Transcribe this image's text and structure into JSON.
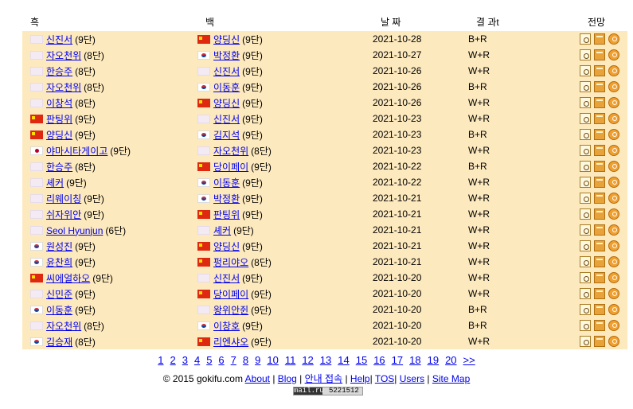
{
  "headers": {
    "black": "흑",
    "white": "백",
    "date": "날 짜",
    "result": "결 과t",
    "view": "전망"
  },
  "rows": [
    {
      "black": {
        "flag": "none",
        "name": "신진서",
        "rank": "(9단)"
      },
      "white": {
        "flag": "cn",
        "name": "양딩신",
        "rank": "(9단)"
      },
      "date": "2021-10-28",
      "result": "B+R"
    },
    {
      "black": {
        "flag": "none",
        "name": "자오천위",
        "rank": "(8단)"
      },
      "white": {
        "flag": "kr",
        "name": "박정환",
        "rank": "(9단)"
      },
      "date": "2021-10-27",
      "result": "W+R"
    },
    {
      "black": {
        "flag": "none",
        "name": "한승주",
        "rank": "(8단)"
      },
      "white": {
        "flag": "none",
        "name": "신진서",
        "rank": "(9단)"
      },
      "date": "2021-10-26",
      "result": "W+R"
    },
    {
      "black": {
        "flag": "none",
        "name": "자오천위",
        "rank": "(8단)"
      },
      "white": {
        "flag": "kr",
        "name": "이동훈",
        "rank": "(9단)"
      },
      "date": "2021-10-26",
      "result": "B+R"
    },
    {
      "black": {
        "flag": "none",
        "name": "이창석",
        "rank": "(8단)"
      },
      "white": {
        "flag": "cn",
        "name": "양딩신",
        "rank": "(9단)"
      },
      "date": "2021-10-26",
      "result": "W+R"
    },
    {
      "black": {
        "flag": "cn",
        "name": "판팅위",
        "rank": "(9단)"
      },
      "white": {
        "flag": "none",
        "name": "신진서",
        "rank": "(9단)"
      },
      "date": "2021-10-23",
      "result": "W+R"
    },
    {
      "black": {
        "flag": "cn",
        "name": "양딩신",
        "rank": "(9단)"
      },
      "white": {
        "flag": "kr",
        "name": "김지석",
        "rank": "(9단)"
      },
      "date": "2021-10-23",
      "result": "B+R"
    },
    {
      "black": {
        "flag": "jp",
        "name": "야마시타게이고",
        "rank": "(9단)"
      },
      "white": {
        "flag": "none",
        "name": "자오천위",
        "rank": "(8단)"
      },
      "date": "2021-10-23",
      "result": "W+R"
    },
    {
      "black": {
        "flag": "none",
        "name": "한승주",
        "rank": "(8단)"
      },
      "white": {
        "flag": "cn",
        "name": "당이페이",
        "rank": "(9단)"
      },
      "date": "2021-10-22",
      "result": "B+R"
    },
    {
      "black": {
        "flag": "none",
        "name": "셰커",
        "rank": "(9단)"
      },
      "white": {
        "flag": "kr",
        "name": "이동훈",
        "rank": "(9단)"
      },
      "date": "2021-10-22",
      "result": "W+R"
    },
    {
      "black": {
        "flag": "none",
        "name": "리웨이칭",
        "rank": "(9단)"
      },
      "white": {
        "flag": "kr",
        "name": "박정환",
        "rank": "(9단)"
      },
      "date": "2021-10-21",
      "result": "W+R"
    },
    {
      "black": {
        "flag": "none",
        "name": "쉬자위안",
        "rank": "(9단)"
      },
      "white": {
        "flag": "cn",
        "name": "판팅위",
        "rank": "(9단)"
      },
      "date": "2021-10-21",
      "result": "W+R"
    },
    {
      "black": {
        "flag": "none",
        "name": "Seol Hyunjun",
        "rank": "(6단)"
      },
      "white": {
        "flag": "none",
        "name": "셰커",
        "rank": "(9단)"
      },
      "date": "2021-10-21",
      "result": "W+R"
    },
    {
      "black": {
        "flag": "kr",
        "name": "원성진",
        "rank": "(9단)"
      },
      "white": {
        "flag": "cn",
        "name": "양딩신",
        "rank": "(9단)"
      },
      "date": "2021-10-21",
      "result": "W+R"
    },
    {
      "black": {
        "flag": "kr",
        "name": "윤찬희",
        "rank": "(9단)"
      },
      "white": {
        "flag": "cn",
        "name": "펑리야오",
        "rank": "(8단)"
      },
      "date": "2021-10-21",
      "result": "W+R"
    },
    {
      "black": {
        "flag": "cn",
        "name": "씨에얼하오",
        "rank": "(9단)"
      },
      "white": {
        "flag": "none",
        "name": "신진서",
        "rank": "(9단)"
      },
      "date": "2021-10-20",
      "result": "W+R"
    },
    {
      "black": {
        "flag": "none",
        "name": "신민준",
        "rank": "(9단)"
      },
      "white": {
        "flag": "cn",
        "name": "당이페이",
        "rank": "(9단)"
      },
      "date": "2021-10-20",
      "result": "W+R"
    },
    {
      "black": {
        "flag": "kr",
        "name": "이동훈",
        "rank": "(9단)"
      },
      "white": {
        "flag": "none",
        "name": "왕위안쥔",
        "rank": "(9단)"
      },
      "date": "2021-10-20",
      "result": "B+R"
    },
    {
      "black": {
        "flag": "none",
        "name": "자오천위",
        "rank": "(8단)"
      },
      "white": {
        "flag": "kr",
        "name": "이창호",
        "rank": "(9단)"
      },
      "date": "2021-10-20",
      "result": "B+R"
    },
    {
      "black": {
        "flag": "kr",
        "name": "김승재",
        "rank": "(8단)"
      },
      "white": {
        "flag": "cn",
        "name": "리엔샤오",
        "rank": "(9단)"
      },
      "date": "2021-10-20",
      "result": "W+R"
    }
  ],
  "pagination": [
    "1",
    "2",
    "3",
    "4",
    "5",
    "6",
    "7",
    "8",
    "9",
    "10",
    "11",
    "12",
    "13",
    "14",
    "15",
    "16",
    "17",
    "18",
    "19",
    "20",
    ">>"
  ],
  "footer": {
    "copyright": "© 2015 gokifu.com",
    "links": [
      "About",
      "Blog",
      "안내 접속",
      "Help",
      "TOS",
      "Users",
      "Site Map"
    ]
  },
  "counter": {
    "brand": "mail.ru",
    "value": "5221512"
  },
  "icons": {
    "view": "view-game-icon",
    "board": "board-icon",
    "download": "download-icon"
  }
}
